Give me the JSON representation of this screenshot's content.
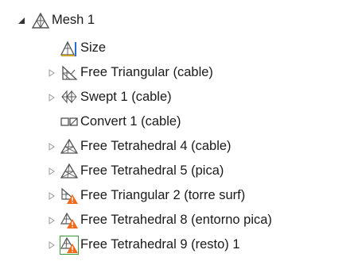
{
  "tree": {
    "root": {
      "label": "Mesh 1",
      "icon": "mesh-icon",
      "expanded": true
    },
    "children": [
      {
        "label": "Size",
        "icon": "size-icon",
        "has_children": false
      },
      {
        "label": "Free Triangular  (cable)",
        "icon": "free-triangular-icon",
        "has_children": true
      },
      {
        "label": "Swept 1 (cable)",
        "icon": "swept-icon",
        "has_children": true
      },
      {
        "label": "Convert 1 (cable)",
        "icon": "convert-icon",
        "has_children": false
      },
      {
        "label": "Free Tetrahedral 4 (cable)",
        "icon": "free-tetrahedral-icon",
        "has_children": true
      },
      {
        "label": "Free Tetrahedral 5 (pica)",
        "icon": "free-tetrahedral-icon",
        "has_children": true
      },
      {
        "label": "Free Triangular 2 (torre surf)",
        "icon": "free-triangular-warning-icon",
        "has_children": true
      },
      {
        "label": "Free Tetrahedral 8 (entorno pica)",
        "icon": "free-tetrahedral-warning-icon",
        "has_children": true
      },
      {
        "label": "Free Tetrahedral 9 (resto) 1",
        "icon": "free-tetrahedral-warning-icon",
        "has_children": true
      }
    ]
  },
  "colors": {
    "warning": "#f26a1b",
    "selection_border": "#3a9a3a",
    "icon_stroke": "#5a5a5a"
  }
}
